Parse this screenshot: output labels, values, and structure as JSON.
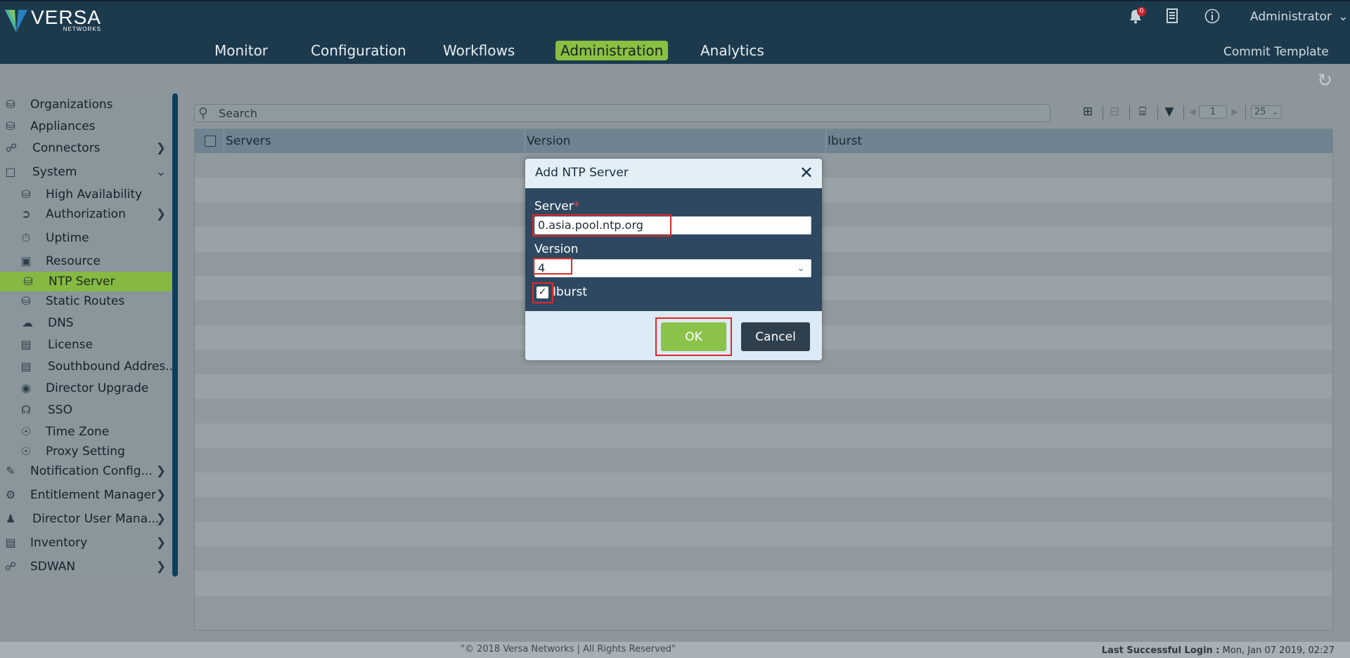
{
  "brand": {
    "name": "VERSA",
    "sub": "NETWORKS"
  },
  "nav": {
    "items": [
      {
        "label": "Monitor",
        "active": false
      },
      {
        "label": "Configuration",
        "active": false
      },
      {
        "label": "Workflows",
        "active": false
      },
      {
        "label": "Administration",
        "active": true
      },
      {
        "label": "Analytics",
        "active": false
      }
    ],
    "commit_label": "Commit Template"
  },
  "header": {
    "notification_count": "0",
    "user_label": "Administrator",
    "icons": [
      "bell-icon",
      "document-list-icon",
      "info-icon",
      "chevron-down-icon"
    ]
  },
  "sidebar": {
    "items": [
      {
        "label": "Organizations",
        "icon": "organizations-icon",
        "level": 0
      },
      {
        "label": "Appliances",
        "icon": "appliances-icon",
        "level": 0
      },
      {
        "label": "Connectors",
        "icon": "connectors-icon",
        "level": 0,
        "chevron": "right"
      },
      {
        "label": "System",
        "icon": "system-icon",
        "level": 0,
        "chevron": "down"
      },
      {
        "label": "High Availability",
        "icon": "high-availability-icon",
        "level": 1
      },
      {
        "label": "Authorization",
        "icon": "authorization-icon",
        "level": 1,
        "chevron": "right"
      },
      {
        "label": "Uptime",
        "icon": "uptime-icon",
        "level": 1
      },
      {
        "label": "Resource",
        "icon": "resource-icon",
        "level": 1
      },
      {
        "label": "NTP Server",
        "icon": "ntp-server-icon",
        "level": 1,
        "active": true
      },
      {
        "label": "Static Routes",
        "icon": "static-routes-icon",
        "level": 1
      },
      {
        "label": "DNS",
        "icon": "dns-icon",
        "level": 1
      },
      {
        "label": "License",
        "icon": "license-icon",
        "level": 1
      },
      {
        "label": "Southbound Addres...",
        "icon": "southbound-address-icon",
        "level": 1
      },
      {
        "label": "Director Upgrade",
        "icon": "director-upgrade-icon",
        "level": 1
      },
      {
        "label": "SSO",
        "icon": "sso-icon",
        "level": 1
      },
      {
        "label": "Time Zone",
        "icon": "time-zone-icon",
        "level": 1
      },
      {
        "label": "Proxy Setting",
        "icon": "proxy-setting-icon",
        "level": 1
      },
      {
        "label": "Notification Config...",
        "icon": "notification-config-icon",
        "level": 0,
        "chevron": "right"
      },
      {
        "label": "Entitlement Manager",
        "icon": "entitlement-manager-icon",
        "level": 0,
        "chevron": "right"
      },
      {
        "label": "Director User Mana...",
        "icon": "director-user-management-icon",
        "level": 0,
        "chevron": "right"
      },
      {
        "label": "Inventory",
        "icon": "inventory-icon",
        "level": 0,
        "chevron": "right"
      },
      {
        "label": "SDWAN",
        "icon": "sdwan-icon",
        "level": 0,
        "chevron": "right"
      }
    ]
  },
  "toolbar": {
    "search_placeholder": "Search",
    "page_number": "1",
    "page_size": "25"
  },
  "grid": {
    "columns": [
      "Servers",
      "Version",
      "Iburst"
    ]
  },
  "modal": {
    "title": "Add NTP Server",
    "server_label": "Server",
    "server_required": "*",
    "server_value": "0.asia.pool.ntp.org",
    "version_label": "Version",
    "version_value": "4",
    "iburst_label": "Iburst",
    "iburst_checked": true,
    "ok_label": "OK",
    "cancel_label": "Cancel"
  },
  "footer": {
    "copyright": "\"© 2018 Versa Networks | All Rights Reserved\"",
    "last_login_label": "Last Successful Login :",
    "last_login_value": "Mon, Jan 07 2019, 02:27"
  },
  "colors": {
    "header_bg": "#1d3a4d",
    "accent_green": "#8bc34a",
    "modal_bg": "#2d4860",
    "highlight_red": "#e02828"
  }
}
